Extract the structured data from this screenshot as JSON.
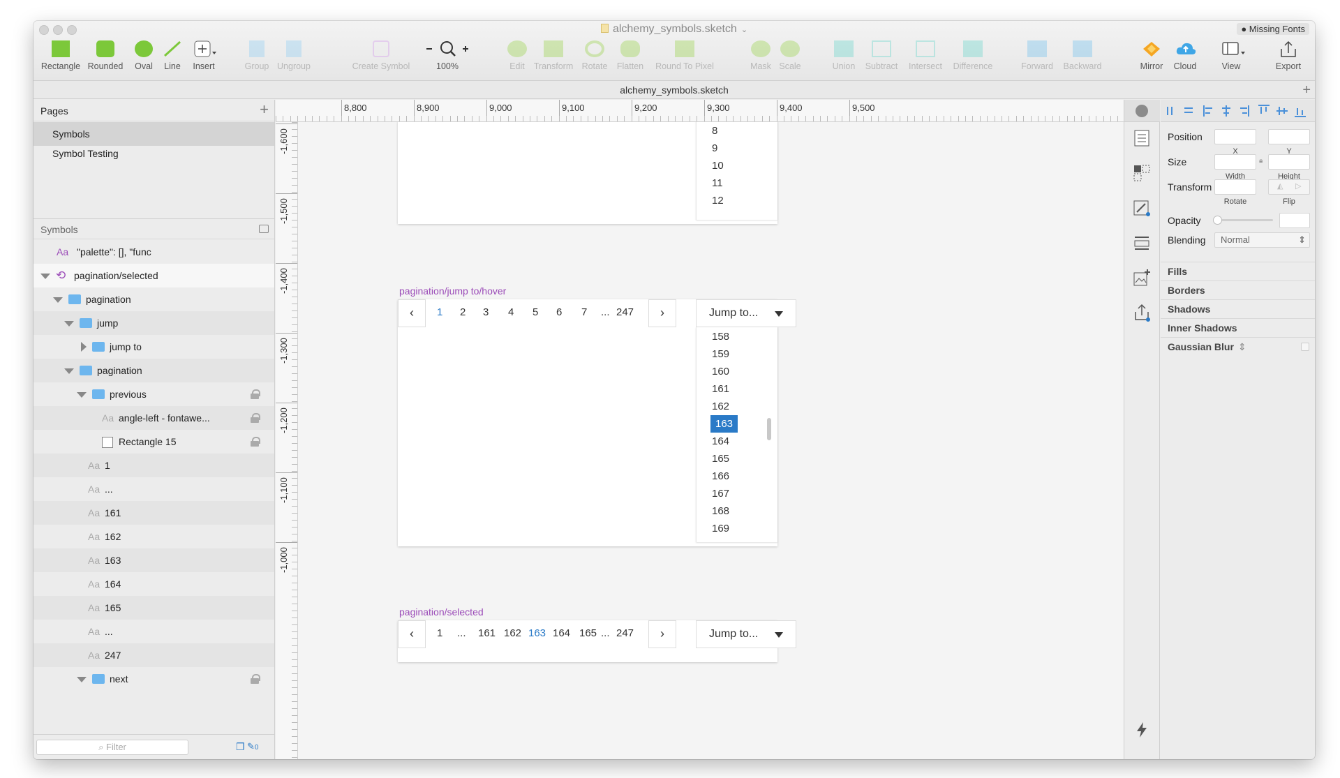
{
  "window": {
    "title": "alchemy_symbols.sketch",
    "missing_fonts": "Missing Fonts",
    "tab_title": "alchemy_symbols.sketch"
  },
  "toolbar": {
    "rectangle": "Rectangle",
    "rounded": "Rounded",
    "oval": "Oval",
    "line": "Line",
    "insert": "Insert",
    "group": "Group",
    "ungroup": "Ungroup",
    "create_symbol": "Create Symbol",
    "zoom": "100%",
    "edit": "Edit",
    "transform": "Transform",
    "rotate": "Rotate",
    "flatten": "Flatten",
    "round_to_pixel": "Round To Pixel",
    "mask": "Mask",
    "scale": "Scale",
    "union": "Union",
    "subtract": "Subtract",
    "intersect": "Intersect",
    "difference": "Difference",
    "forward": "Forward",
    "backward": "Backward",
    "mirror": "Mirror",
    "cloud": "Cloud",
    "view": "View",
    "export": "Export"
  },
  "pages": {
    "header": "Pages",
    "items": [
      "Symbols",
      "Symbol Testing"
    ]
  },
  "layers": {
    "header": "Symbols",
    "items": [
      {
        "label": "\"palette\": [], \"func"
      },
      {
        "label": "pagination/selected"
      },
      {
        "label": "pagination"
      },
      {
        "label": "jump"
      },
      {
        "label": "jump to"
      },
      {
        "label": "pagination"
      },
      {
        "label": "previous"
      },
      {
        "label": "angle-left - fontawe..."
      },
      {
        "label": "Rectangle 15"
      },
      {
        "label": "1"
      },
      {
        "label": "..."
      },
      {
        "label": "161"
      },
      {
        "label": "162"
      },
      {
        "label": "163"
      },
      {
        "label": "164"
      },
      {
        "label": "165"
      },
      {
        "label": "..."
      },
      {
        "label": "247"
      },
      {
        "label": "next"
      }
    ],
    "filter_placeholder": "Filter",
    "badge": "0"
  },
  "rulers": {
    "h": [
      "8,800",
      "8,900",
      "9,000",
      "9,100",
      "9,200",
      "9,300",
      "9,400",
      "9,500"
    ],
    "v": [
      "-1,600",
      "-1,500",
      "-1,400",
      "-1,300",
      "-1,200",
      "-1,100",
      "-1,000"
    ]
  },
  "artboards": {
    "top_list": [
      "8",
      "9",
      "10",
      "11",
      "12"
    ],
    "hover": {
      "label": "pagination/jump to/hover",
      "prev": "‹",
      "next": "›",
      "pages": [
        "1",
        "2",
        "3",
        "4",
        "5",
        "6",
        "7",
        "...",
        "247"
      ],
      "jump": "Jump to...",
      "list": [
        "158",
        "159",
        "160",
        "161",
        "162",
        "163",
        "164",
        "165",
        "166",
        "167",
        "168",
        "169"
      ],
      "highlighted": "163"
    },
    "selected": {
      "label": "pagination/selected",
      "prev": "‹",
      "next": "›",
      "pages": [
        "1",
        "...",
        "161",
        "162",
        "163",
        "164",
        "165",
        "...",
        "247"
      ],
      "jump": "Jump to..."
    }
  },
  "inspector": {
    "position": "Position",
    "x": "X",
    "y": "Y",
    "size": "Size",
    "width": "Width",
    "height": "Height",
    "transform": "Transform",
    "rotate": "Rotate",
    "flip": "Flip",
    "opacity": "Opacity",
    "blending": "Blending",
    "blending_value": "Normal",
    "sections": [
      "Fills",
      "Borders",
      "Shadows",
      "Inner Shadows",
      "Gaussian Blur"
    ]
  },
  "colors": {
    "accent": "#2a7ac7",
    "symbol_label": "#9b4bb8",
    "folder": "#6db6ee"
  }
}
